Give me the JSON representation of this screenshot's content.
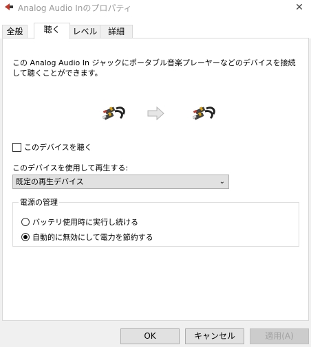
{
  "window": {
    "title": "Analog Audio Inのプロパティ",
    "close_glyph": "✕"
  },
  "tabs": [
    {
      "label": "全般",
      "active": false
    },
    {
      "label": "聴く",
      "active": true
    },
    {
      "label": "レベル",
      "active": false
    },
    {
      "label": "詳細",
      "active": false
    }
  ],
  "listen": {
    "description": "この Analog Audio In ジャックにポータブル音楽プレーヤーなどのデバイスを接続して聴くことができます。",
    "checkbox_label": "このデバイスを聴く",
    "checkbox_checked": false,
    "playback_label": "このデバイスを使用して再生する:",
    "playback_device": "既定の再生デバイス",
    "power_group_title": "電源の管理",
    "radio_battery_label": "バッテリ使用時に実行し続ける",
    "radio_auto_label": "自動的に無効にして電力を節約する",
    "selected_radio": "auto"
  },
  "footer": {
    "ok_label": "OK",
    "cancel_label": "キャンセル",
    "apply_label": "適用(A)"
  },
  "icons": {
    "title": "audio-jack-icon",
    "source": "rca-cable-icon",
    "arrow": "right-arrow-icon",
    "target": "rca-cable-icon"
  }
}
